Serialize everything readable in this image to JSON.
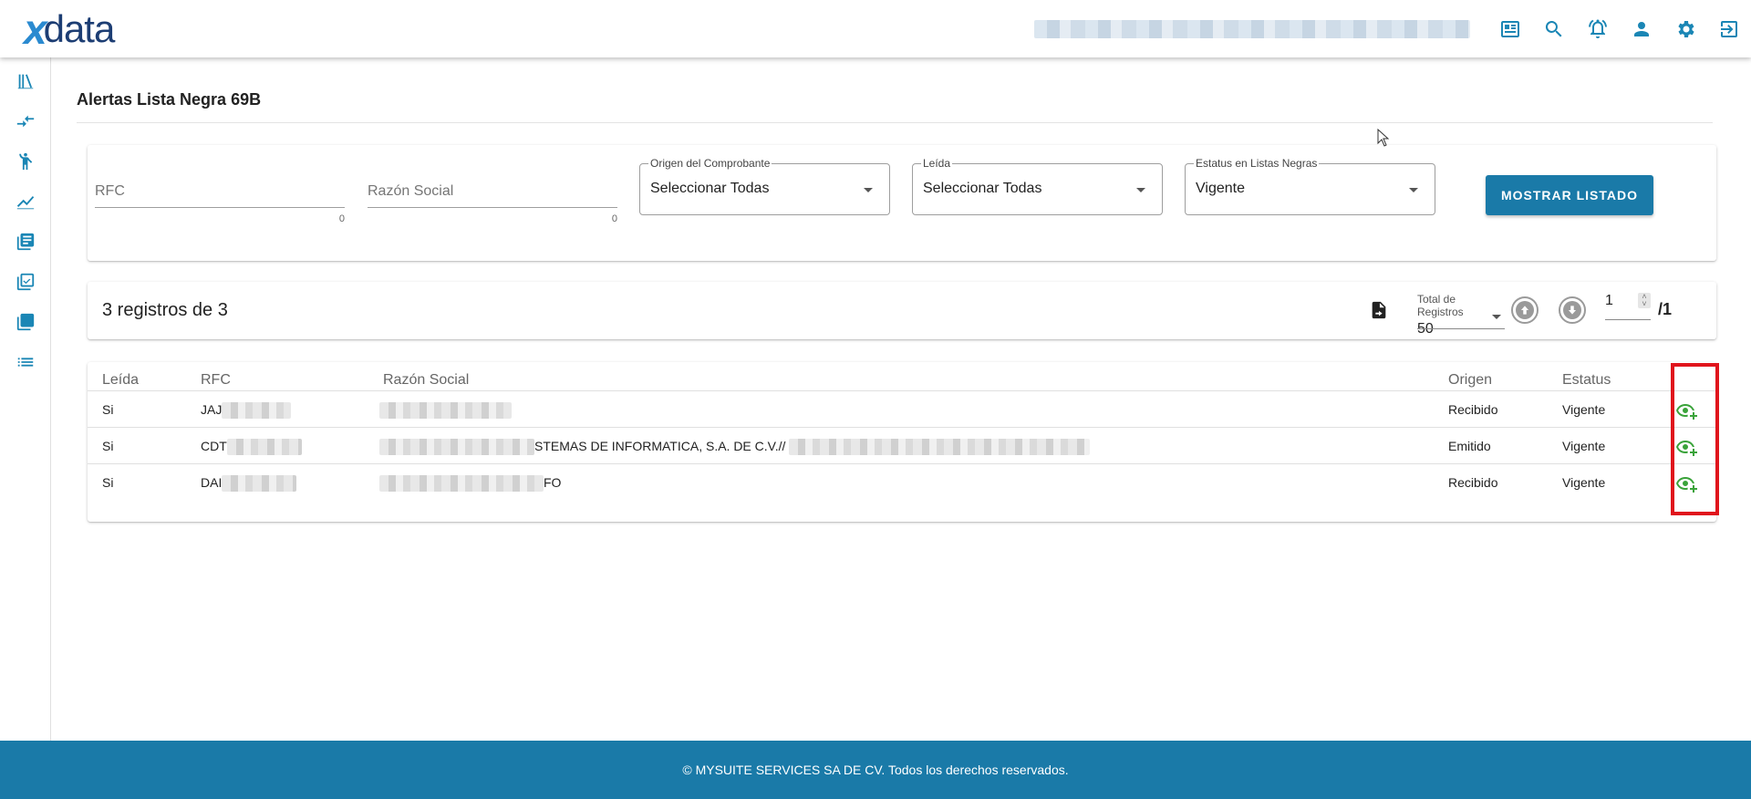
{
  "app": {
    "logo_mark": "x",
    "logo_word": "data",
    "user_info": ""
  },
  "top_icons": [
    "profile-card-icon",
    "search-icon",
    "notifications-icon",
    "user-icon",
    "settings-icon",
    "logout-icon"
  ],
  "sidebar": [
    "library-icon",
    "compare-arrows-icon",
    "accessibility-icon",
    "trending-up-icon",
    "document-list-icon",
    "copy-check-icon",
    "collections-icon",
    "list-icon"
  ],
  "page": {
    "title": "Alertas Lista Negra 69B"
  },
  "filters": {
    "rfc": {
      "placeholder": "RFC",
      "count": "0"
    },
    "razon": {
      "placeholder": "Razón Social",
      "count": "0"
    },
    "origen": {
      "label": "Origen del Comprobante",
      "value": "Seleccionar Todas"
    },
    "leida": {
      "label": "Leída",
      "value": "Seleccionar Todas"
    },
    "estatus": {
      "label": "Estatus en Listas Negras",
      "value": "Vigente"
    },
    "submit_label": "MOSTRAR LISTADO"
  },
  "summary": {
    "text": "3 registros de 3",
    "total_label": "Total de Registros",
    "total_value": "50",
    "page": "1",
    "page_total": "/1"
  },
  "table": {
    "headers": {
      "leida": "Leída",
      "rfc": "RFC",
      "razon": "Razón Social",
      "origen": "Origen",
      "estatus": "Estatus"
    },
    "rows": [
      {
        "leida": "Si",
        "rfc": "JAJ",
        "razon_visible": "",
        "origen": "Recibido",
        "estatus": "Vigente"
      },
      {
        "leida": "Si",
        "rfc": "CDT",
        "razon_visible": "STEMAS DE INFORMATICA, S.A. DE C.V.// ",
        "origen": "Emitido",
        "estatus": "Vigente"
      },
      {
        "leida": "Si",
        "rfc": "DAI",
        "razon_visible": "FO",
        "origen": "Recibido",
        "estatus": "Vigente"
      }
    ]
  },
  "footer": {
    "text": "© MYSUITE SERVICES SA DE CV. Todos los derechos reservados."
  },
  "colors": {
    "primary": "#1a7aa8",
    "icon": "#1a86b5",
    "view_icon": "#3aa33a",
    "highlight": "#e0141c"
  }
}
